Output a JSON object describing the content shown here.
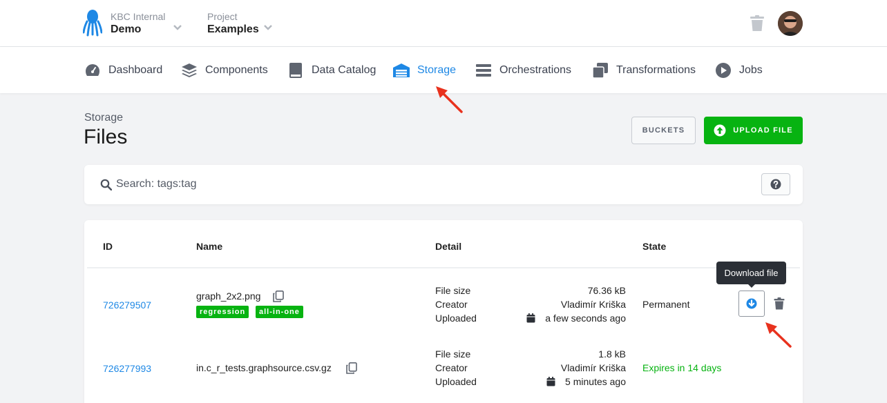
{
  "header": {
    "org_label": "KBC Internal",
    "org_name": "Demo",
    "project_label": "Project",
    "project_name": "Examples"
  },
  "nav": {
    "items": [
      {
        "label": "Dashboard",
        "icon": "dashboard-gauge-icon"
      },
      {
        "label": "Components",
        "icon": "layers-icon"
      },
      {
        "label": "Data Catalog",
        "icon": "book-icon"
      },
      {
        "label": "Storage",
        "icon": "warehouse-icon",
        "active": true
      },
      {
        "label": "Orchestrations",
        "icon": "bars-icon"
      },
      {
        "label": "Transformations",
        "icon": "window-restore-icon"
      },
      {
        "label": "Jobs",
        "icon": "play-circle-icon"
      }
    ]
  },
  "page": {
    "breadcrumb": "Storage",
    "title": "Files",
    "buckets_label": "BUCKETS",
    "upload_label": "UPLOAD FILE"
  },
  "search": {
    "placeholder": "Search: tags:tag"
  },
  "table": {
    "headers": {
      "id": "ID",
      "name": "Name",
      "detail": "Detail",
      "state": "State"
    },
    "detail_labels": {
      "size": "File size",
      "creator": "Creator",
      "uploaded": "Uploaded"
    },
    "rows": [
      {
        "id": "726279507",
        "name": "graph_2x2.png",
        "tags": [
          "regression",
          "all-in-one"
        ],
        "size": "76.36 kB",
        "creator": "Vladimír Kriška",
        "uploaded": "a few seconds ago",
        "state": "Permanent"
      },
      {
        "id": "726277993",
        "name": "in.c_r_tests.graphsource.csv.gz",
        "tags": [],
        "size": "1.8 kB",
        "creator": "Vladimír Kriška",
        "uploaded": "5 minutes ago",
        "state": "Expires in 14 days"
      }
    ]
  },
  "tooltip": {
    "text": "Download file"
  },
  "colors": {
    "accent": "#1e88e5",
    "success": "#07b311",
    "annotation": "#e8321e"
  }
}
